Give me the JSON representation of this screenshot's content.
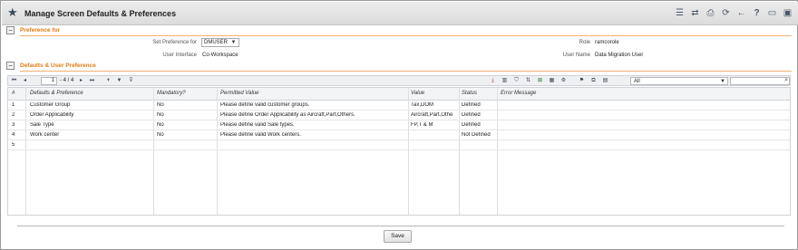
{
  "window": {
    "title": "Manage Screen Defaults & Preferences"
  },
  "toolbar_icons": [
    "list-icon",
    "shuffle-icon",
    "print-icon",
    "refresh-icon",
    "back-arrow-icon",
    "help-icon",
    "window-icon",
    "maximize-icon"
  ],
  "preference_section": {
    "label": "Preference for",
    "set_preference_label": "Set Preference for",
    "set_preference_value": "DMUSER",
    "role_label": "Role",
    "role_value": "ramcorole",
    "ui_label": "User Interface",
    "ui_value": "Co-Workspace",
    "user_name_label": "User Name",
    "user_name_value": "Data Migration User"
  },
  "defaults_section": {
    "label": "Defaults & User Preference"
  },
  "grid_toolbar": {
    "page_input": "1",
    "page_text": "- 4 / 4",
    "filter_value": "All",
    "search_value": ""
  },
  "grid": {
    "headers": [
      "#",
      "Defaults & Preference",
      "Mandatory?",
      "Permitted Value",
      "Value",
      "Status",
      "Error Message"
    ],
    "rows": [
      {
        "num": "1",
        "pref": "Customer Group",
        "mandatory": "No",
        "permitted": "Please define valid customer groups.",
        "value": "Tax,DOM",
        "status": "Defined",
        "error": ""
      },
      {
        "num": "2",
        "pref": "Order Applicability",
        "mandatory": "No",
        "permitted": "Please define Order Applicability as Aircraft,Part,Others.",
        "value": "Aircraft,Part,Othe",
        "status": "Defined",
        "error": ""
      },
      {
        "num": "3",
        "pref": "Sale Type",
        "mandatory": "No",
        "permitted": "Please define valid Sale types.",
        "value": "FP,T & M",
        "status": "Defined",
        "error": ""
      },
      {
        "num": "4",
        "pref": "Work center",
        "mandatory": "No",
        "permitted": "Please define valid Work centers.",
        "value": "",
        "status": "Not Defined",
        "error": ""
      },
      {
        "num": "5",
        "pref": "",
        "mandatory": "",
        "permitted": "",
        "value": "",
        "status": "",
        "error": ""
      }
    ]
  },
  "footer": {
    "save_label": "Save"
  }
}
